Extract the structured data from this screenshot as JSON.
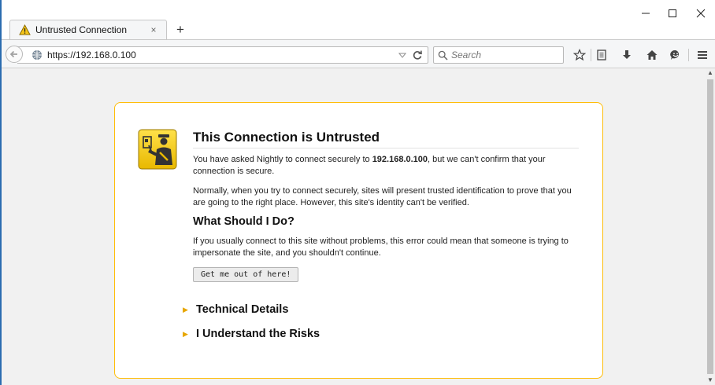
{
  "window": {
    "minimize_glyph": "—",
    "maximize_glyph": "☐",
    "close_glyph": "✕"
  },
  "tab": {
    "title": "Untrusted Connection",
    "icon": "warning-triangle-icon",
    "close_glyph": "×"
  },
  "newtab_glyph": "+",
  "navbar": {
    "url": "https://192.168.0.100",
    "search_placeholder": "Search",
    "icons": [
      "star-icon",
      "reading-list-icon",
      "download-icon",
      "home-icon",
      "hello-chat-icon",
      "menu-icon"
    ]
  },
  "error": {
    "title": "This Connection is Untrusted",
    "p1_before": "You have asked Nightly to connect securely to ",
    "p1_host": "192.168.0.100",
    "p1_after": ", but we can't confirm that your connection is secure.",
    "p2": "Normally, when you try to connect securely, sites will present trusted identification to prove that you are going to the right place. However, this site's identity can't be verified.",
    "h2": "What Should I Do?",
    "p3": "If you usually connect to this site without problems, this error could mean that someone is trying to impersonate the site, and you shouldn't continue.",
    "button": "Get me out of here!",
    "technical_details": "Technical Details",
    "understand_risks": "I Understand the Risks"
  },
  "colors": {
    "box_border": "#ffbd09",
    "page_bg": "#f1f1f1",
    "accent": "#2b6cb0",
    "expander_arrow": "#e7a600"
  }
}
